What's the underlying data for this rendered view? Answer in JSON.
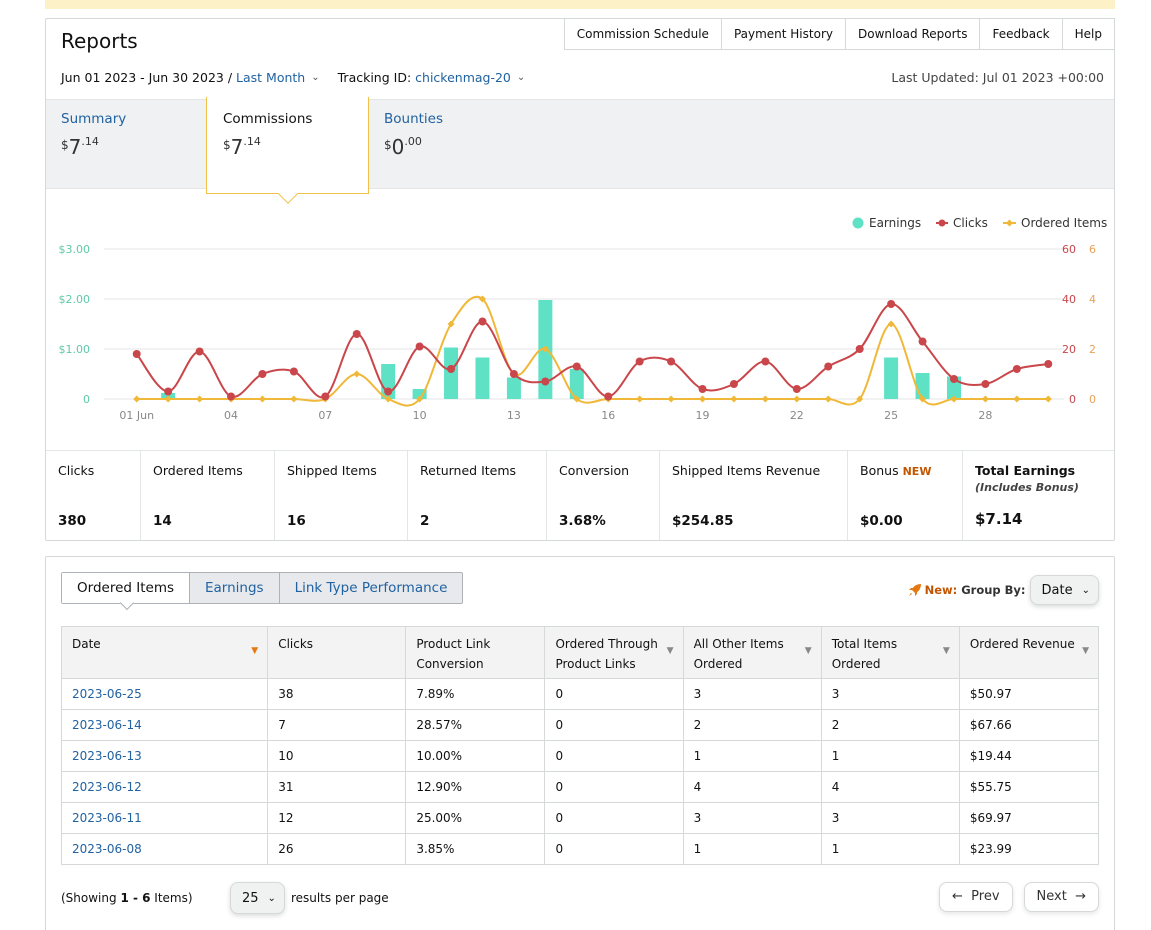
{
  "header": {
    "title": "Reports",
    "nav": [
      "Commission Schedule",
      "Payment History",
      "Download Reports",
      "Feedback",
      "Help"
    ],
    "date_range": "Jun 01 2023 - Jun 30 2023 /",
    "period": "Last Month",
    "tracking_label": "Tracking ID:",
    "tracking_id": "chickenmag-20",
    "last_updated": "Last Updated: Jul 01 2023 +00:00"
  },
  "tabs": [
    {
      "label": "Summary",
      "currency": "$",
      "whole": "7",
      "cents": ".14"
    },
    {
      "label": "Commissions",
      "currency": "$",
      "whole": "7",
      "cents": ".14"
    },
    {
      "label": "Bounties",
      "currency": "$",
      "whole": "0",
      "cents": ".00"
    }
  ],
  "chart_data": {
    "type": "line",
    "x_tick_labels": [
      "01 Jun",
      "04",
      "07",
      "10",
      "13",
      "16",
      "19",
      "22",
      "25",
      "28"
    ],
    "x": [
      1,
      2,
      3,
      4,
      5,
      6,
      7,
      8,
      9,
      10,
      11,
      12,
      13,
      14,
      15,
      16,
      17,
      18,
      19,
      20,
      21,
      22,
      23,
      24,
      25,
      26,
      27,
      28,
      29,
      30
    ],
    "legend": [
      "Earnings",
      "Clicks",
      "Ordered Items"
    ],
    "legend_position": "top-right",
    "y_left_ticks": [
      "$3.00",
      "$2.00",
      "$1.00",
      "0"
    ],
    "y_left_range": [
      0,
      3
    ],
    "y_clicks_ticks": [
      "60",
      "40",
      "20",
      "0"
    ],
    "y_clicks_range": [
      0,
      60
    ],
    "y_items_ticks": [
      "6",
      "4",
      "2",
      "0"
    ],
    "y_items_range": [
      0,
      6
    ],
    "grid": true,
    "colors": {
      "earnings": "#5ee1c5",
      "clicks": "#c9464a",
      "items": "#f0b838",
      "left_axis": "#5ec9a8",
      "right_axis": "#c9464a",
      "right2_axis": "#e8a25a"
    },
    "series": [
      {
        "name": "Earnings",
        "kind": "bar",
        "values": [
          0,
          0.12,
          0,
          0,
          0,
          0,
          0,
          0,
          0.7,
          0.2,
          1.03,
          0.83,
          0.43,
          1.98,
          0.6,
          0,
          0,
          0,
          0,
          0,
          0,
          0,
          0,
          0,
          0.83,
          0.52,
          0.45,
          0,
          0,
          0
        ]
      },
      {
        "name": "Clicks",
        "kind": "line",
        "values": [
          18,
          3,
          19,
          1,
          10,
          11,
          1,
          26,
          3,
          21,
          12,
          31,
          10,
          7,
          13,
          1,
          15,
          15,
          4,
          6,
          15,
          4,
          13,
          20,
          38,
          23,
          8,
          6,
          12,
          14
        ]
      },
      {
        "name": "Ordered Items",
        "kind": "line",
        "values": [
          0,
          0,
          0,
          0,
          0,
          0,
          0,
          1,
          0,
          0,
          3,
          4,
          1,
          2,
          0,
          0,
          0,
          0,
          0,
          0,
          0,
          0,
          0,
          0,
          3,
          0,
          0,
          0,
          0,
          0
        ]
      }
    ]
  },
  "stats": [
    {
      "label": "Clicks",
      "value": "380"
    },
    {
      "label": "Ordered Items",
      "value": "14"
    },
    {
      "label": "Shipped Items",
      "value": "16"
    },
    {
      "label": "Returned Items",
      "value": "2"
    },
    {
      "label": "Conversion",
      "value": "3.68%"
    },
    {
      "label": "Shipped Items Revenue",
      "value": "$254.85"
    },
    {
      "label": "Bonus",
      "badge": "NEW",
      "value": "$0.00"
    },
    {
      "label": "Total Earnings",
      "sub": "(Includes Bonus)",
      "value": "$7.14"
    }
  ],
  "table_tabs": [
    "Ordered Items",
    "Earnings",
    "Link Type Performance"
  ],
  "group_by": {
    "new": "New:",
    "label": "Group By:",
    "value": "Date"
  },
  "table": {
    "columns": [
      [
        "Date"
      ],
      [
        "Clicks"
      ],
      [
        "Product Link",
        "Conversion"
      ],
      [
        "Ordered Through",
        "Product Links"
      ],
      [
        "All Other Items",
        "Ordered"
      ],
      [
        "Total Items",
        "Ordered"
      ],
      [
        "Ordered Revenue"
      ]
    ],
    "rows": [
      [
        "2023-06-25",
        "38",
        "7.89%",
        "0",
        "3",
        "3",
        "$50.97"
      ],
      [
        "2023-06-14",
        "7",
        "28.57%",
        "0",
        "2",
        "2",
        "$67.66"
      ],
      [
        "2023-06-13",
        "10",
        "10.00%",
        "0",
        "1",
        "1",
        "$19.44"
      ],
      [
        "2023-06-12",
        "31",
        "12.90%",
        "0",
        "4",
        "4",
        "$55.75"
      ],
      [
        "2023-06-11",
        "12",
        "25.00%",
        "0",
        "3",
        "3",
        "$69.97"
      ],
      [
        "2023-06-08",
        "26",
        "3.85%",
        "0",
        "1",
        "1",
        "$23.99"
      ]
    ]
  },
  "footer": {
    "showing_prefix": "(Showing ",
    "showing_range": "1 - 6",
    "showing_suffix": " Items)",
    "per_page": "25",
    "per_page_label": "results per page",
    "prev": "Prev",
    "next": "Next"
  }
}
